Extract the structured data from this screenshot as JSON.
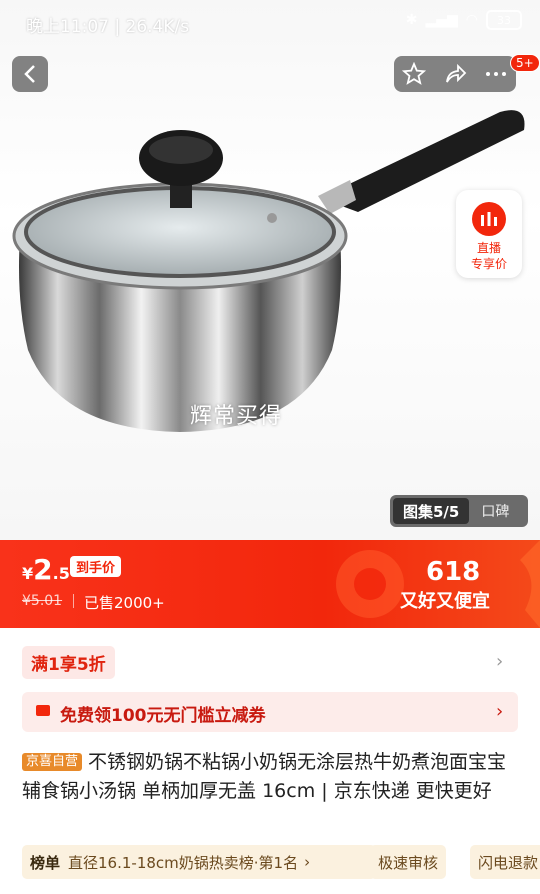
{
  "status_bar": {
    "time": "晚上11:07 | 26.4K/s",
    "battery": "33"
  },
  "header": {
    "badge": "5+"
  },
  "live": {
    "line1": "直播",
    "line2": "专享价"
  },
  "gallery": {
    "watermark": "辉常买得",
    "active_tab": "图集5/5",
    "other_tab": "口碑"
  },
  "price": {
    "currency": "¥",
    "integer": "2",
    "decimal": ".5",
    "tag": "到手价",
    "original": "¥5.01",
    "sold": "已售2000+",
    "promo_number": "618",
    "promo_slogan": "又好又便宜"
  },
  "coupons": {
    "discount": "满1享5折",
    "coupon": "免费领100元无门槛立减券"
  },
  "product": {
    "self_tag": "京喜自营",
    "title": "不锈钢奶锅不粘锅小奶锅无涂层热牛奶煮泡面宝宝辅食锅小汤锅 单柄加厚无盖 16cm | 京东快递 更快更好"
  },
  "chips": {
    "rank_label": "榜单",
    "rank_text": "直径16.1-18cm奶锅热卖榜·第1名",
    "review": "极速审核",
    "refund": "闪电退款"
  },
  "colors": {
    "brand_red": "#f2270c",
    "chip_bg": "#fbf1df"
  }
}
